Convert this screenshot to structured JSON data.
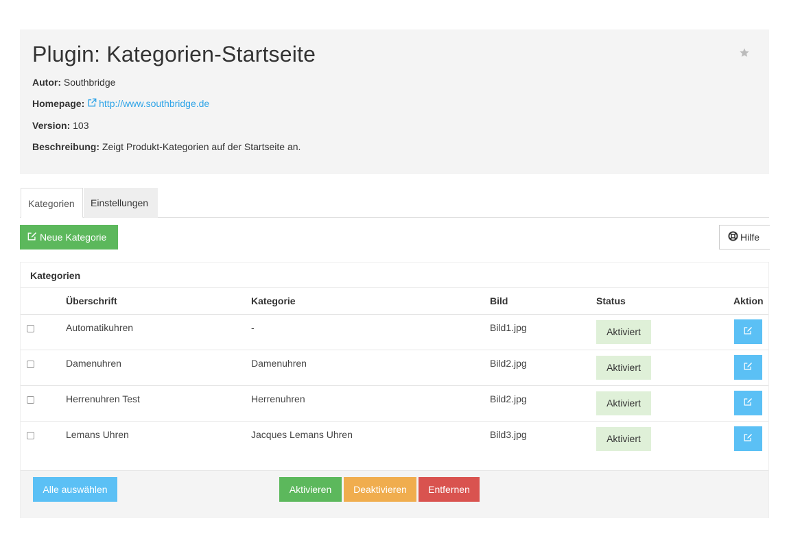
{
  "plugin": {
    "title": "Plugin: Kategorien-Startseite",
    "author_label": "Autor:",
    "author": "Southbridge",
    "homepage_label": "Homepage:",
    "homepage_url": "http://www.southbridge.de",
    "version_label": "Version:",
    "version": "103",
    "description_label": "Beschreibung:",
    "description": "Zeigt Produkt-Kategorien auf der Startseite an."
  },
  "tabs": [
    {
      "label": "Kategorien",
      "active": true
    },
    {
      "label": "Einstellungen",
      "active": false
    }
  ],
  "toolbar": {
    "new_label": "Neue Kategorie",
    "help_label": "Hilfe"
  },
  "panel": {
    "heading": "Kategorien",
    "columns": [
      "Überschrift",
      "Kategorie",
      "Bild",
      "Status",
      "Aktion"
    ],
    "rows": [
      {
        "title": "Automatikuhren",
        "category": "-",
        "image": "Bild1.jpg",
        "status": "Aktiviert"
      },
      {
        "title": "Damenuhren",
        "category": "Damenuhren",
        "image": "Bild2.jpg",
        "status": "Aktiviert"
      },
      {
        "title": "Herrenuhren Test",
        "category": "Herrenuhren",
        "image": "Bild2.jpg",
        "status": "Aktiviert"
      },
      {
        "title": "Lemans Uhren",
        "category": "Jacques Lemans Uhren",
        "image": "Bild3.jpg",
        "status": "Aktiviert"
      }
    ]
  },
  "footer": {
    "select_all_label": "Alle auswählen",
    "activate_label": "Aktivieren",
    "deactivate_label": "Deaktivieren",
    "remove_label": "Entfernen"
  },
  "colors": {
    "success": "#5cb85c",
    "info": "#5bc0f5",
    "warning": "#f0ad4e",
    "danger": "#d9534f",
    "link": "#2fa4e7",
    "status_bg": "#dff0d8"
  },
  "icons": {
    "favorite": "star-icon",
    "homepage": "external-link-icon",
    "new": "edit-icon",
    "help": "life-ring-icon",
    "row_action": "edit-icon"
  }
}
